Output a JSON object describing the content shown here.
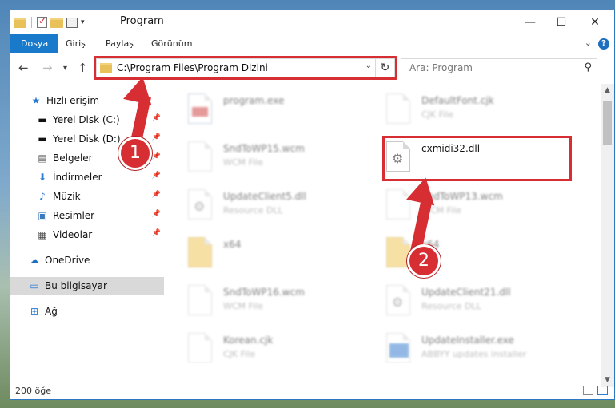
{
  "window": {
    "title": "Program",
    "controls": {
      "minimize": "—",
      "maximize": "☐",
      "close": "✕"
    }
  },
  "ribbon": {
    "tabs": [
      "Dosya",
      "Giriş",
      "Paylaş",
      "Görünüm"
    ],
    "help": "?"
  },
  "navigation": {
    "back": "←",
    "forward": "→",
    "recent": "▾",
    "up": "↑",
    "address": "C:\\Program Files\\Program Dizini",
    "search_placeholder": "Ara: Program"
  },
  "sidebar": {
    "items": [
      {
        "label": "Hızlı erişim",
        "icon": "star-icon",
        "pinned": false
      },
      {
        "label": "Yerel Disk (C:)",
        "icon": "drive-icon",
        "pinned": true
      },
      {
        "label": "Yerel Disk (D:)",
        "icon": "drive-icon",
        "pinned": true
      },
      {
        "label": "Belgeler",
        "icon": "documents-icon",
        "pinned": true
      },
      {
        "label": "İndirmeler",
        "icon": "download-icon",
        "pinned": true
      },
      {
        "label": "Müzik",
        "icon": "music-icon",
        "pinned": true
      },
      {
        "label": "Resimler",
        "icon": "pictures-icon",
        "pinned": true
      },
      {
        "label": "Videolar",
        "icon": "video-icon",
        "pinned": true
      },
      {
        "label": "OneDrive",
        "icon": "cloud-icon",
        "pinned": false
      },
      {
        "label": "Bu bilgisayar",
        "icon": "computer-icon",
        "pinned": false,
        "selected": true
      },
      {
        "label": "Ağ",
        "icon": "network-icon",
        "pinned": false
      }
    ]
  },
  "files": [
    {
      "name": "program.exe",
      "type": "",
      "icon": "exe-icon"
    },
    {
      "name": "DefaultFont.cjk",
      "type": "CJK File",
      "icon": "file-icon"
    },
    {
      "name": "SndToWP15.wcm",
      "type": "WCM File",
      "icon": "file-icon"
    },
    {
      "name": "cxmidi32.dll",
      "type": "",
      "icon": "dll-gear-icon"
    },
    {
      "name": "UpdateClient5.dll",
      "type": "Resource DLL",
      "icon": "dll-gear-icon"
    },
    {
      "name": "SndToWP13.wcm",
      "type": "WCM File",
      "icon": "file-icon"
    },
    {
      "name": "x64",
      "type": "",
      "icon": "folder-icon"
    },
    {
      "name": "x64",
      "type": "",
      "icon": "folder-icon"
    },
    {
      "name": "SndToWP16.wcm",
      "type": "WCM File",
      "icon": "file-icon"
    },
    {
      "name": "UpdateClient21.dll",
      "type": "Resource DLL",
      "icon": "dll-gear-icon"
    },
    {
      "name": "Korean.cjk",
      "type": "CJK File",
      "icon": "file-icon"
    },
    {
      "name": "UpdateInstaller.exe",
      "type": "ABBYY updates installer",
      "icon": "installer-icon"
    }
  ],
  "status": {
    "count": "200 öğe"
  },
  "annotations": {
    "badge1": "1",
    "badge2": "2"
  },
  "colors": {
    "accent": "#1979ca",
    "highlight": "#d72e34"
  }
}
